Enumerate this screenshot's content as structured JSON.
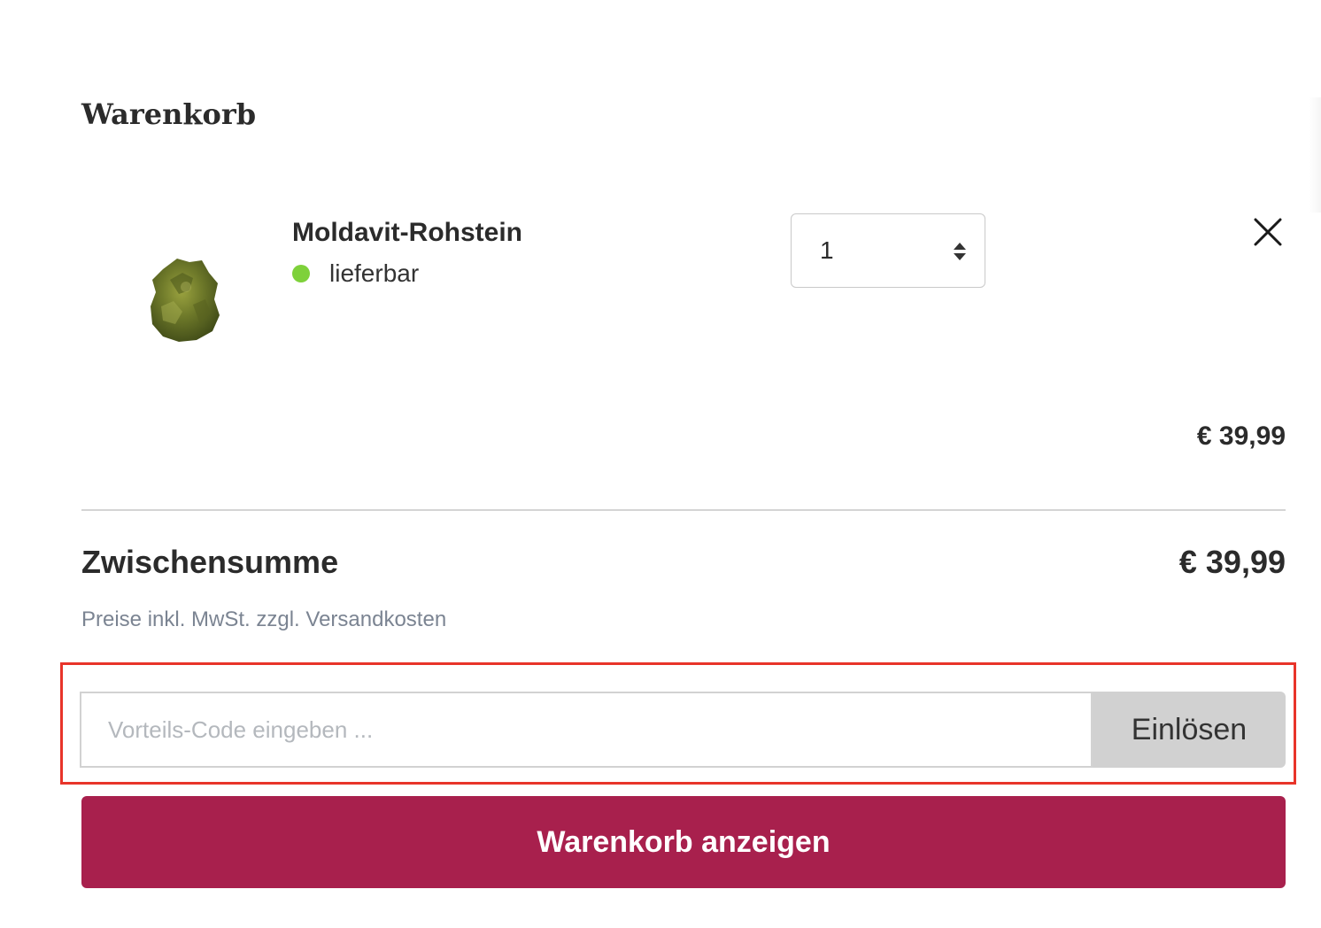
{
  "cart": {
    "title": "Warenkorb"
  },
  "item": {
    "name": "Moldavit-Rohstein",
    "availability": "lieferbar",
    "availability_color": "#7ed13a",
    "quantity": "1",
    "price": "€ 39,99",
    "image_icon": "moldavite-stone-image",
    "remove_icon": "close-icon"
  },
  "summary": {
    "subtotal_label": "Zwischensumme",
    "subtotal_value": "€ 39,99",
    "tax_note": "Preise inkl. MwSt. zzgl. Versandkosten"
  },
  "coupon": {
    "placeholder": "Vorteils-Code eingeben ...",
    "value": "",
    "redeem_label": "Einlösen",
    "highlight_color": "#e8342a"
  },
  "actions": {
    "view_cart_label": "Warenkorb anzeigen",
    "view_cart_color": "#a8204d"
  }
}
